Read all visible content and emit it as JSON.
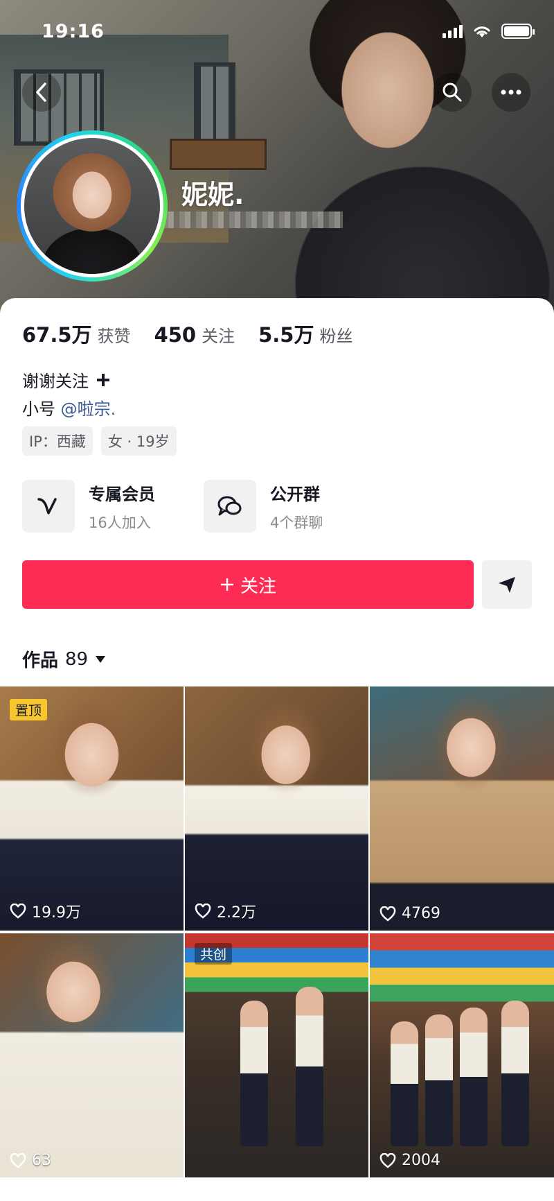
{
  "status_bar": {
    "time": "19:16"
  },
  "profile": {
    "nickname": "妮妮.",
    "stats": [
      {
        "num": "67.5万",
        "label": "获赞"
      },
      {
        "num": "450",
        "label": "关注"
      },
      {
        "num": "5.5万",
        "label": "粉丝"
      }
    ],
    "bio_line1": "谢谢关注",
    "bio_line2_prefix": "小号",
    "bio_line2_mention": "@啦宗.",
    "tags": [
      "IP：西藏",
      "女 · 19岁"
    ]
  },
  "features": [
    {
      "title": "专属会员",
      "sub": "16人加入"
    },
    {
      "title": "公开群",
      "sub": "4个群聊"
    }
  ],
  "follow_label": "关注",
  "works": {
    "label": "作品",
    "count": "89"
  },
  "videos": [
    {
      "likes": "19.9万",
      "badge": "置顶"
    },
    {
      "likes": "2.2万",
      "badge": ""
    },
    {
      "likes": "4769",
      "badge": ""
    },
    {
      "likes": "63",
      "badge": ""
    },
    {
      "likes": "",
      "badge": "共创"
    },
    {
      "likes": "2004",
      "badge": ""
    }
  ],
  "colors": {
    "accent": "#fe2c55",
    "mention": "#3a5b96",
    "pin_badge": "#f8c72e"
  }
}
